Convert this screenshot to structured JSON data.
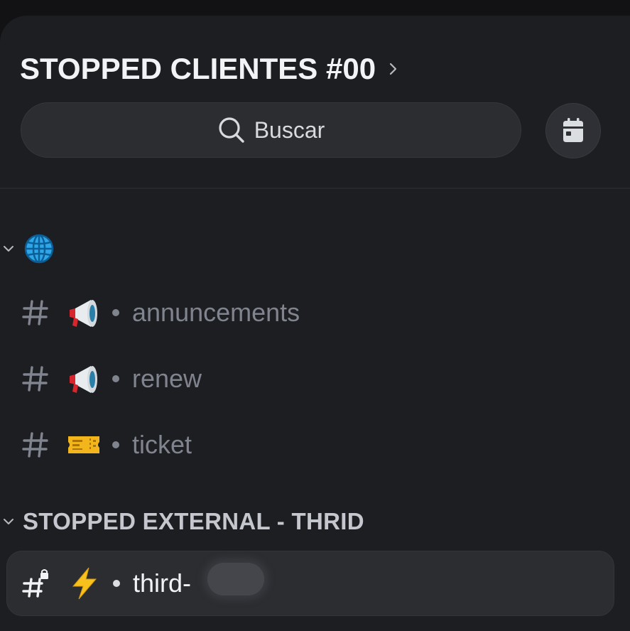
{
  "server": {
    "name": "STOPPED CLIENTES #00"
  },
  "search": {
    "label": "Buscar"
  },
  "categories": [
    {
      "name": "",
      "icon": "globe-icon",
      "channels": [
        {
          "emoji": "megaphone-icon",
          "name": "annuncements"
        },
        {
          "emoji": "megaphone-icon",
          "name": "renew"
        },
        {
          "emoji": "ticket-icon",
          "name": "ticket"
        }
      ]
    },
    {
      "name": "STOPPED EXTERNAL - THRID",
      "channels": [
        {
          "emoji": "lightning-icon",
          "name": "third-",
          "locked": true,
          "selected": true
        }
      ]
    }
  ],
  "colors": {
    "panel_bg": "#1d1e22",
    "text_muted": "#80848e",
    "text_bright": "#f2f3f5"
  }
}
